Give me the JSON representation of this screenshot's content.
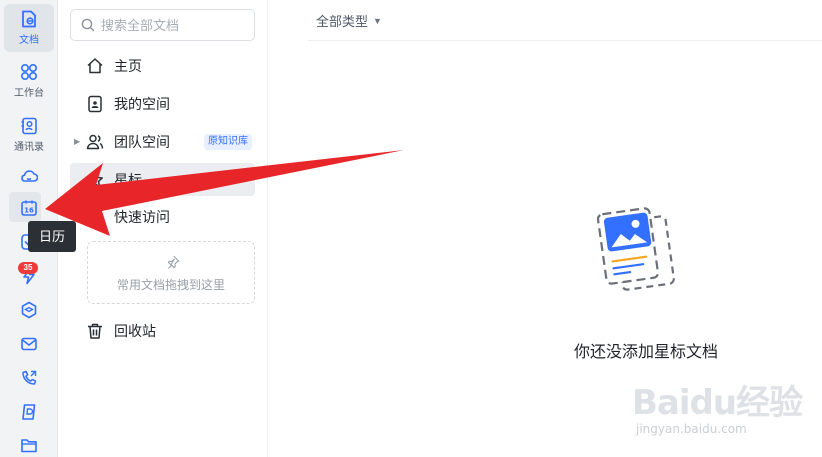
{
  "rail": {
    "items": [
      {
        "key": "docs",
        "label": "文档",
        "icon": "document-icon"
      },
      {
        "key": "workbench",
        "label": "工作台",
        "icon": "grid-apps-icon"
      },
      {
        "key": "contacts",
        "label": "通讯录",
        "icon": "contacts-icon"
      },
      {
        "key": "cloud",
        "label": "",
        "icon": "cloud-icon"
      },
      {
        "key": "calendar",
        "label": "",
        "icon": "calendar-icon",
        "day": "16"
      },
      {
        "key": "todo",
        "label": "",
        "icon": "todo-check-icon"
      },
      {
        "key": "flash",
        "label": "",
        "icon": "flash-icon",
        "badge": "35"
      },
      {
        "key": "cube",
        "label": "",
        "icon": "cube-icon"
      },
      {
        "key": "mail",
        "label": "",
        "icon": "mail-icon"
      },
      {
        "key": "phone",
        "label": "",
        "icon": "phone-icon"
      },
      {
        "key": "doc2",
        "label": "",
        "icon": "doc-d-icon"
      },
      {
        "key": "folder",
        "label": "",
        "icon": "folder-icon"
      }
    ],
    "tooltip": "日历"
  },
  "panel": {
    "search_placeholder": "搜索全部文档",
    "nav": [
      {
        "key": "home",
        "label": "主页",
        "icon": "home-icon"
      },
      {
        "key": "my_space",
        "label": "我的空间",
        "icon": "my-space-icon"
      },
      {
        "key": "team_space",
        "label": "团队空间",
        "icon": "team-icon",
        "tag": "原知识库"
      },
      {
        "key": "starred",
        "label": "星标",
        "icon": "star-icon"
      },
      {
        "key": "quick_access",
        "label": "快速访问",
        "icon": "pin-icon"
      },
      {
        "key": "trash",
        "label": "回收站",
        "icon": "trash-icon"
      }
    ],
    "drop_zone_text": "常用文档拖拽到这里"
  },
  "main": {
    "filter_label": "全部类型",
    "empty_text": "你还没添加星标文档"
  },
  "watermark": {
    "line1": "Baidu经验",
    "line2": "jingyan.baidu.com"
  },
  "colors": {
    "accent": "#3370ff",
    "arrow": "#e8262a",
    "badge": "#f03a3a"
  }
}
